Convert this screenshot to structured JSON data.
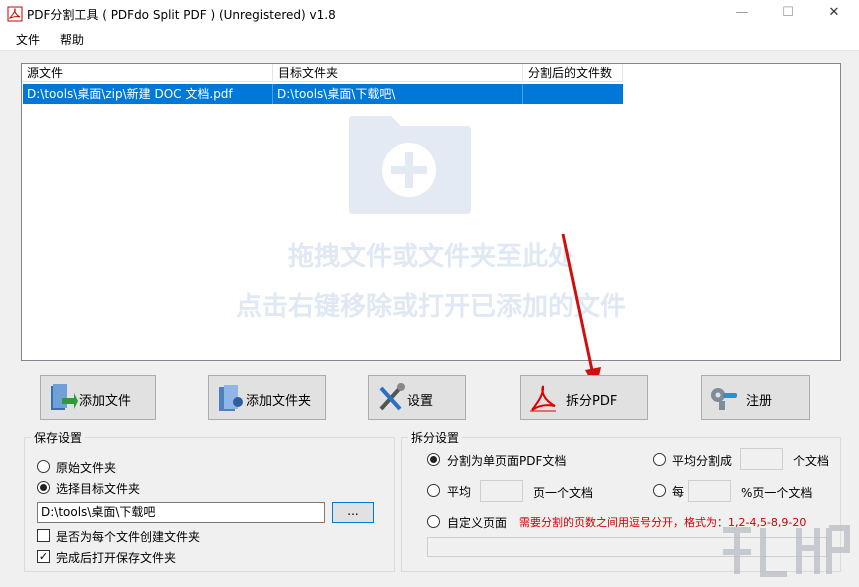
{
  "window": {
    "title": "PDF分割工具 ( PDFdo Split PDF ) (Unregistered) v1.8"
  },
  "menu": [
    "文件",
    "帮助"
  ],
  "file_list": {
    "columns": [
      "源文件",
      "目标文件夹",
      "分割后的文件数"
    ],
    "rows": [
      {
        "source": "D:\\tools\\桌面\\zip\\新建 DOC 文档.pdf",
        "target": "D:\\tools\\桌面\\下载吧\\",
        "count": ""
      }
    ],
    "hint_line1": "拖拽文件或文件夹至此处",
    "hint_line2": "点击右键移除或打开已添加的文件"
  },
  "toolbar": {
    "add_file": "添加文件",
    "add_folder": "添加文件夹",
    "settings": "设置",
    "split_pdf": "拆分PDF",
    "register": "注册"
  },
  "save_settings": {
    "title": "保存设置",
    "original_folder": "原始文件夹",
    "choose_target": "选择目标文件夹",
    "path_value": "D:\\tools\\桌面\\下载吧",
    "browse": "...",
    "create_folder_each": "是否为每个文件创建文件夹",
    "open_after": "完成后打开保存文件夹"
  },
  "split_settings": {
    "title": "拆分设置",
    "single_page": "分割为单页面PDF文档",
    "split_evenly": "平均分割成",
    "docs_suffix": "个文档",
    "average": "平均",
    "pages_per_doc": "页一个文档",
    "every": "每",
    "percent_per_doc": "%页一个文档",
    "custom_pages": "自定义页面",
    "custom_hint": "需要分割的页数之间用逗号分开，格式为：1,2-4,5-8,9-20"
  },
  "colors": {
    "selection": "#0078d7",
    "hint_text": "#dfe8f3",
    "warning": "#d00000"
  }
}
